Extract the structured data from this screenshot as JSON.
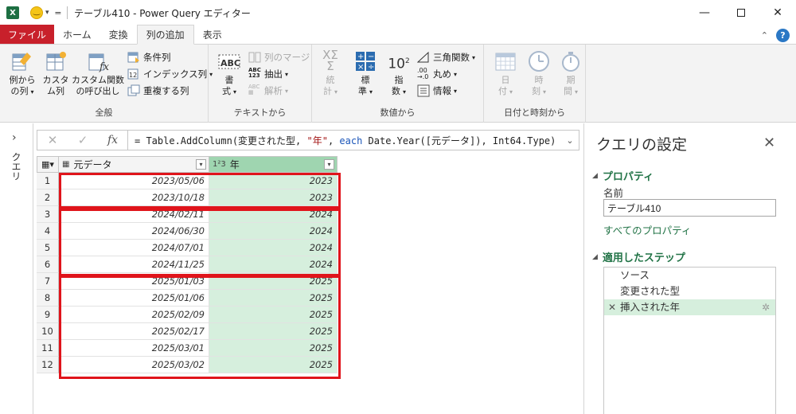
{
  "window": {
    "title": "テーブル410 - Power Query エディター",
    "app_badge": "X"
  },
  "tabs": [
    "ファイル",
    "ホーム",
    "変換",
    "列の追加",
    "表示"
  ],
  "active_tab": "列の追加",
  "ribbon": {
    "general": {
      "label": "全般",
      "col_from_examples_1": "例から",
      "col_from_examples_2": "の列",
      "custom_col_1": "カスタ",
      "custom_col_2": "ム列",
      "invoke_fn_1": "カスタム関数",
      "invoke_fn_2": "の呼び出し",
      "conditional": "条件列",
      "index": "インデックス列",
      "duplicate": "重複する列"
    },
    "text": {
      "label": "テキストから",
      "format_1": "書",
      "format_2": "式",
      "merge": "列のマージ",
      "extract": "抽出",
      "parse": "解析"
    },
    "number": {
      "label": "数値から",
      "stats_1": "統",
      "stats_2": "計",
      "standard_1": "標",
      "standard_2": "準",
      "sci_1": "指",
      "sci_2": "数",
      "trig": "三角関数",
      "round": "丸め",
      "info": "情報"
    },
    "datetime": {
      "label": "日付と時刻から",
      "date_1": "日",
      "date_2": "付",
      "time_1": "時",
      "time_2": "刻",
      "duration_1": "期",
      "duration_2": "間"
    }
  },
  "left_pane": {
    "label": "クエリ"
  },
  "formula": {
    "prefix": "= Table.AddColumn(変更された型, ",
    "str": "\"年\"",
    "sep": ", ",
    "kw": "each",
    "suffix": " Date.Year([元データ]), Int64.Type)"
  },
  "grid": {
    "col1": "元データ",
    "col2": "年",
    "col2_type": "1²3",
    "rows": [
      {
        "n": "1",
        "date": "2023/05/06",
        "year": "2023"
      },
      {
        "n": "2",
        "date": "2023/10/18",
        "year": "2023"
      },
      {
        "n": "3",
        "date": "2024/02/11",
        "year": "2024"
      },
      {
        "n": "4",
        "date": "2024/06/30",
        "year": "2024"
      },
      {
        "n": "5",
        "date": "2024/07/01",
        "year": "2024"
      },
      {
        "n": "6",
        "date": "2024/11/25",
        "year": "2024"
      },
      {
        "n": "7",
        "date": "2025/01/03",
        "year": "2025"
      },
      {
        "n": "8",
        "date": "2025/01/06",
        "year": "2025"
      },
      {
        "n": "9",
        "date": "2025/02/09",
        "year": "2025"
      },
      {
        "n": "10",
        "date": "2025/02/17",
        "year": "2025"
      },
      {
        "n": "11",
        "date": "2025/03/01",
        "year": "2025"
      },
      {
        "n": "12",
        "date": "2025/03/02",
        "year": "2025"
      }
    ]
  },
  "settings": {
    "title": "クエリの設定",
    "properties_heading": "プロパティ",
    "name_label": "名前",
    "name_value": "テーブル410",
    "all_properties": "すべてのプロパティ",
    "steps_heading": "適用したステップ",
    "steps": [
      "ソース",
      "変更された型",
      "挿入された年"
    ],
    "active_step": "挿入された年"
  },
  "colors": {
    "accent_green": "#217346",
    "file_tab_red": "#c8202b",
    "highlight_red": "#e0141b",
    "selected_column": "#d6efdd"
  }
}
